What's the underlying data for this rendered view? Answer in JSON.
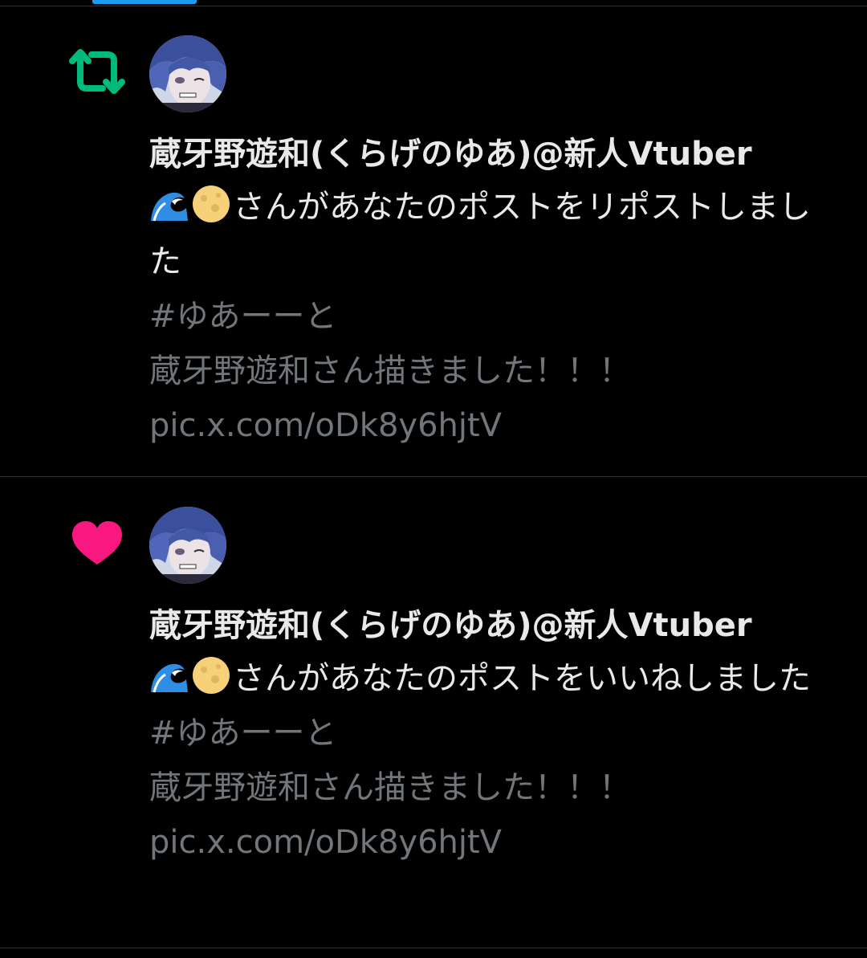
{
  "notifications": [
    {
      "type": "repost",
      "icon": "repost-icon",
      "icon_color": "#00ba7c",
      "author": "蔵牙野遊和(くらげのゆあ)@新人Vtuber",
      "message_emojis": [
        "wave-emoji",
        "moon-emoji"
      ],
      "message": "さんがあなたのポストをリポストしました",
      "excerpt_hashtag": "#ゆあーーと",
      "excerpt_text": "蔵牙野遊和さん描きました！！！",
      "excerpt_link": "pic.x.com/oDk8y6hjtV"
    },
    {
      "type": "like",
      "icon": "heart-icon",
      "icon_color": "#f91880",
      "author": "蔵牙野遊和(くらげのゆあ)@新人Vtuber",
      "message_emojis": [
        "wave-emoji",
        "moon-emoji"
      ],
      "message": "さんがあなたのポストをいいねしました",
      "excerpt_hashtag": "#ゆあーーと",
      "excerpt_text": "蔵牙野遊和さん描きました！！！",
      "excerpt_link": "pic.x.com/oDk8y6hjtV"
    }
  ],
  "colors": {
    "background": "#000000",
    "primary_text": "#e7e9ea",
    "secondary_text": "#71767b",
    "divider": "#2f3336",
    "accent": "#1d9bf0"
  }
}
